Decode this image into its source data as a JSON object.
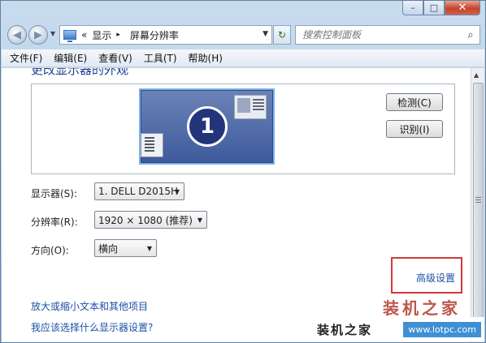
{
  "window": {
    "minimize_glyph": "–",
    "maximize_glyph": "□",
    "close_glyph": "✕"
  },
  "navigation": {
    "back_glyph": "◀",
    "forward_glyph": "▶",
    "breadcrumb_prefix": "«",
    "breadcrumb": [
      "显示",
      "屏幕分辨率"
    ],
    "breadcrumb_separator": "▸",
    "refresh_glyph": "↻",
    "search_placeholder": "搜索控制面板",
    "search_glyph": "⌕"
  },
  "menu": [
    "文件(F)",
    "编辑(E)",
    "查看(V)",
    "工具(T)",
    "帮助(H)"
  ],
  "page": {
    "title": "更改显示器的外观",
    "monitor_number": "1",
    "detect_label": "检测(C)",
    "identify_label": "识别(I)"
  },
  "fields": {
    "display": {
      "label": "显示器(S):",
      "value": "1. DELL D2015H"
    },
    "resolution": {
      "label": "分辨率(R):",
      "value": "1920 × 1080 (推荐)"
    },
    "orientation": {
      "label": "方向(O):",
      "value": "横向"
    }
  },
  "links": {
    "advanced": "高级设置",
    "text_size": "放大或缩小文本和其他项目",
    "which_settings": "我应该选择什么显示器设置?"
  },
  "watermark": {
    "overlay": "装机之家",
    "brand": "装机之家",
    "url": "www.lotpc.com"
  },
  "colors": {
    "link": "#1c4fa6",
    "highlight_box": "#d03a3a",
    "title": "#1e3f8f"
  }
}
